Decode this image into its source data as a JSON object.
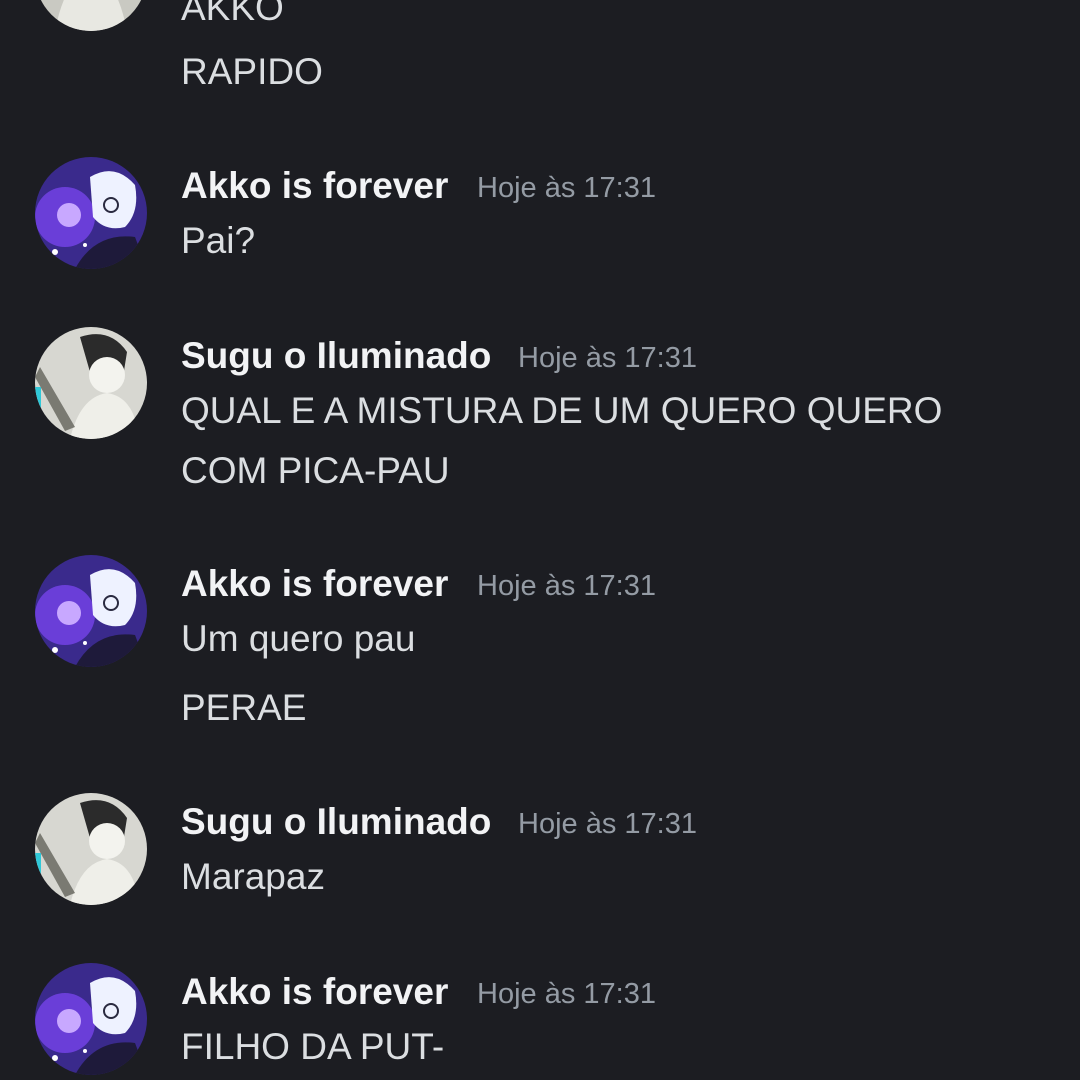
{
  "messages": [
    {
      "author": "",
      "time": "",
      "lines": [
        "AKKO",
        "RAPIDO"
      ],
      "avatar": "akko-avatar"
    },
    {
      "author": "Akko is forever",
      "time": "Hoje às 17:31",
      "lines": [
        "Pai?"
      ],
      "avatar": "akko-avatar"
    },
    {
      "author": "Sugu o Iluminado",
      "time": "Hoje às 17:31",
      "lines": [
        "QUAL E A MISTURA DE UM QUERO QUERO",
        "COM PICA-PAU"
      ],
      "avatar": "sugu-avatar"
    },
    {
      "author": "Akko is forever",
      "time": "Hoje às 17:31",
      "lines": [
        "Um quero pau",
        "PERAE"
      ],
      "avatar": "akko-avatar"
    },
    {
      "author": "Sugu o Iluminado",
      "time": "Hoje às 17:31",
      "lines": [
        "Marapaz"
      ],
      "avatar": "sugu-avatar"
    },
    {
      "author": "Akko is forever",
      "time": "Hoje às 17:31",
      "lines": [
        "FILHO DA PUT-"
      ],
      "avatar": "akko-avatar"
    }
  ],
  "colors": {
    "background": "#1c1d22",
    "author": "#f2f3f5",
    "timestamp": "#949ba4",
    "message": "#dbdee1"
  }
}
